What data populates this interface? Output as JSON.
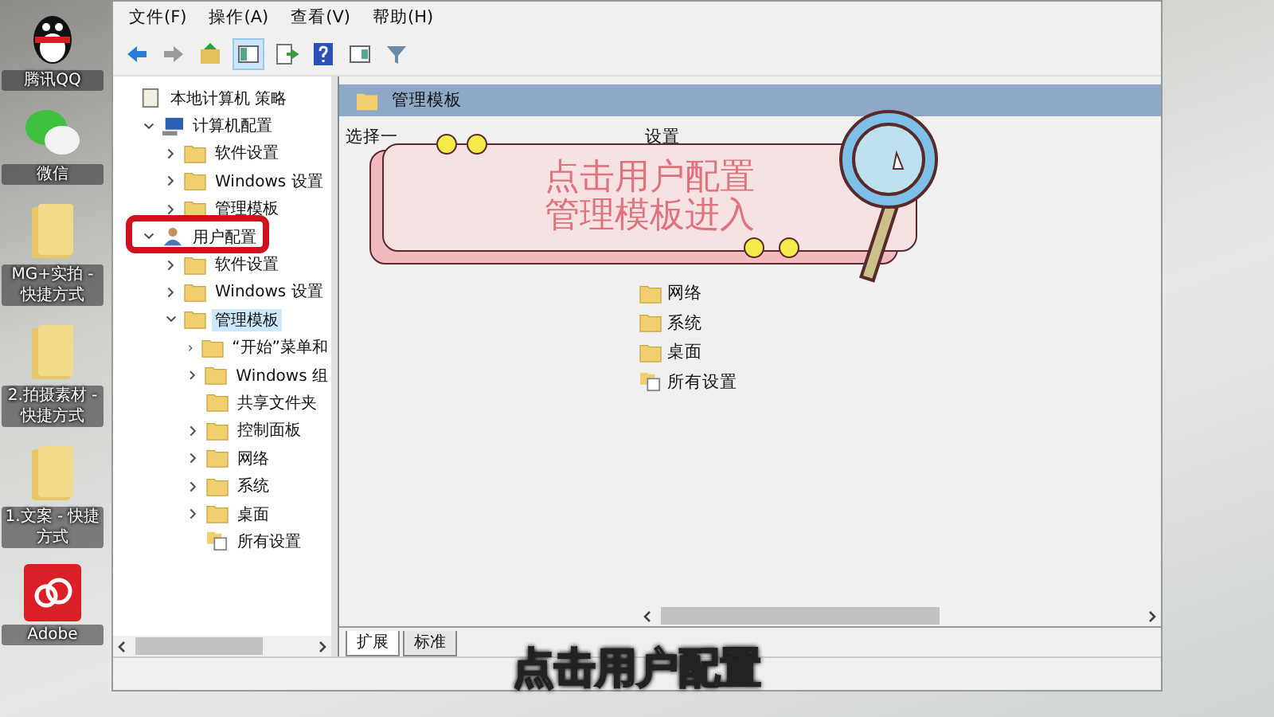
{
  "desktop_icons": [
    {
      "label": "腾讯QQ",
      "kind": "qq"
    },
    {
      "label": "微信",
      "kind": "wechat"
    },
    {
      "label": "MG+实拍 - 快捷方式",
      "kind": "folder"
    },
    {
      "label": "2.拍摄素材 - 快捷方式",
      "kind": "folder"
    },
    {
      "label": "1.文案 - 快捷方式",
      "kind": "folder"
    },
    {
      "label": "Adobe",
      "kind": "adobe"
    }
  ],
  "window": {
    "menu": [
      "文件(F)",
      "操作(A)",
      "查看(V)",
      "帮助(H)"
    ],
    "tree": [
      {
        "label": "本地计算机 策略",
        "kind": "policy",
        "selected": false,
        "children": [
          {
            "label": "计算机配置",
            "kind": "computer",
            "selected": false,
            "expanded": true,
            "children": [
              {
                "label": "软件设置",
                "kind": "folder",
                "selected": false,
                "expanded": false
              },
              {
                "label": "Windows 设置",
                "kind": "folder",
                "selected": false,
                "expanded": false
              },
              {
                "label": "管理模板",
                "kind": "folder",
                "selected": false,
                "expanded": false
              }
            ]
          },
          {
            "label": "用户配置",
            "kind": "user",
            "selected": false,
            "expanded": true,
            "highlighted": true,
            "children": [
              {
                "label": "软件设置",
                "kind": "folder",
                "selected": false,
                "expanded": false
              },
              {
                "label": "Windows 设置",
                "kind": "folder",
                "selected": false,
                "expanded": false
              },
              {
                "label": "管理模板",
                "kind": "folder",
                "selected": true,
                "expanded": true,
                "children": [
                  {
                    "label": "“开始”菜单和",
                    "kind": "folder",
                    "selected": false,
                    "expanded": false
                  },
                  {
                    "label": "Windows 组",
                    "kind": "folder",
                    "selected": false,
                    "expanded": false
                  },
                  {
                    "label": "共享文件夹",
                    "kind": "folder",
                    "selected": false
                  },
                  {
                    "label": "控制面板",
                    "kind": "folder",
                    "selected": false,
                    "expanded": false
                  },
                  {
                    "label": "网络",
                    "kind": "folder",
                    "selected": false,
                    "expanded": false
                  },
                  {
                    "label": "系统",
                    "kind": "folder",
                    "selected": false,
                    "expanded": false
                  },
                  {
                    "label": "桌面",
                    "kind": "folder",
                    "selected": false,
                    "expanded": false
                  },
                  {
                    "label": "所有设置",
                    "kind": "settings",
                    "selected": false
                  }
                ]
              }
            ]
          }
        ]
      }
    ],
    "pane_title": "管理模板",
    "description": "选择一",
    "list_header": "设置",
    "list_items": [
      {
        "label": "网络",
        "kind": "folder"
      },
      {
        "label": "系统",
        "kind": "folder"
      },
      {
        "label": "桌面",
        "kind": "folder"
      },
      {
        "label": "所有设置",
        "kind": "settings"
      }
    ],
    "tabs": [
      {
        "label": "扩展",
        "selected": true
      },
      {
        "label": "标准",
        "selected": false
      }
    ]
  },
  "callout": {
    "lines": [
      "点击用户配置",
      "管理模板进入"
    ]
  },
  "subtitle": "点击用户配置"
}
